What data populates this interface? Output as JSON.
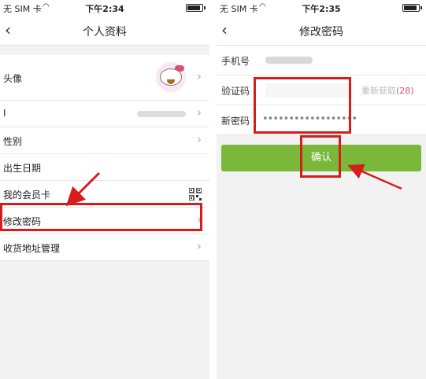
{
  "status": {
    "carrier": "无 SIM 卡",
    "left_time": "下午2:34",
    "right_time": "下午2:35"
  },
  "left_screen": {
    "title": "个人资料",
    "back_icon": "chevron-left-icon",
    "rows": [
      {
        "label": "头像"
      },
      {
        "label": "I"
      },
      {
        "label": "性别"
      },
      {
        "label": "出生日期"
      },
      {
        "label": "我的会员卡"
      },
      {
        "label": "修改密码"
      },
      {
        "label": "收货地址管理"
      }
    ]
  },
  "right_screen": {
    "title": "修改密码",
    "back_icon": "chevron-left-icon",
    "phone_label": "手机号",
    "code_label": "验证码",
    "resend_label": "重新获取",
    "resend_count": "(28)",
    "new_password_label": "新密码",
    "password_mask": "••••••••••••••••••",
    "confirm_label": "确认"
  },
  "annotations": {
    "highlight_color": "#d81c1c",
    "button_color": "#7ab83a"
  }
}
